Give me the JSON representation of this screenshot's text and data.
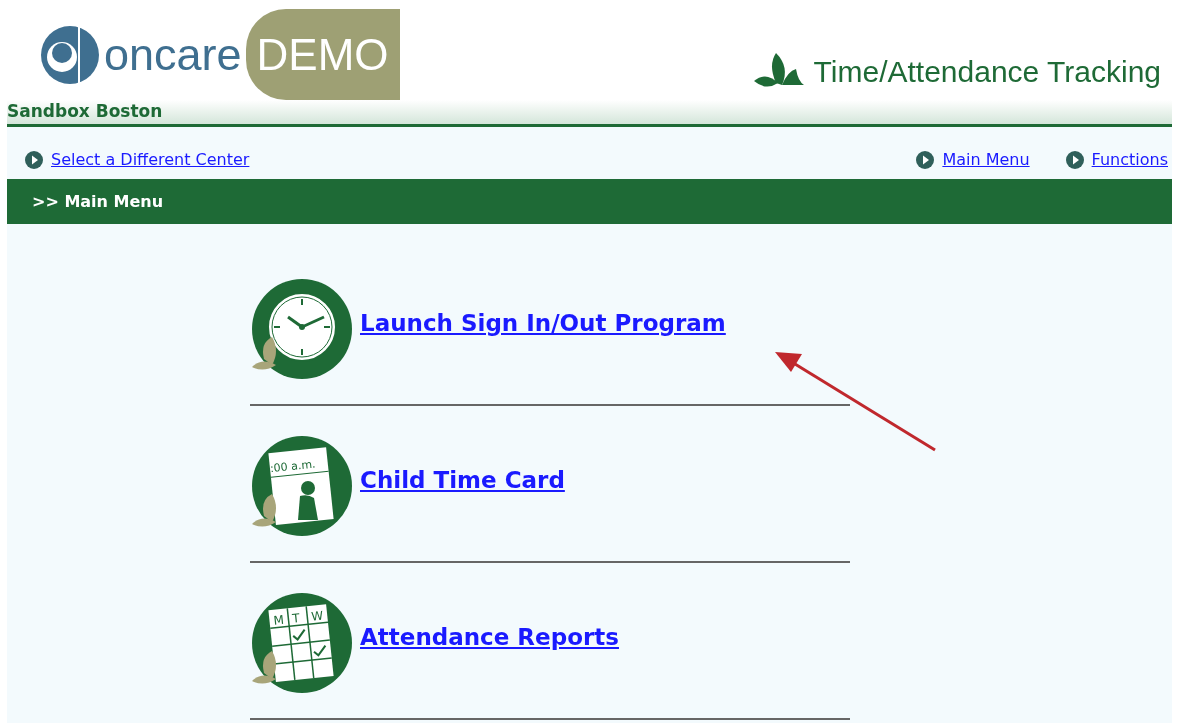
{
  "logo": {
    "word": "oncare",
    "badge": "DEMO"
  },
  "app_title": "Time/Attendance Tracking",
  "center_name": "Sandbox Boston",
  "nav_left": [
    {
      "label": "Select a Different Center"
    }
  ],
  "nav_right": [
    {
      "label": "Main Menu"
    },
    {
      "label": "Functions"
    }
  ],
  "breadcrumb": ">> Main Menu",
  "menu_items": [
    {
      "label": "Launch Sign In/Out Program",
      "kind": "clock"
    },
    {
      "label": "Child Time Card",
      "kind": "timecard",
      "icon_text": [
        ":00 a.m."
      ]
    },
    {
      "label": "Attendance Reports",
      "kind": "calendar",
      "icon_text": [
        "M",
        "T",
        "W"
      ]
    }
  ],
  "annotation": {
    "kind": "arrow",
    "color": "#c0282d"
  }
}
